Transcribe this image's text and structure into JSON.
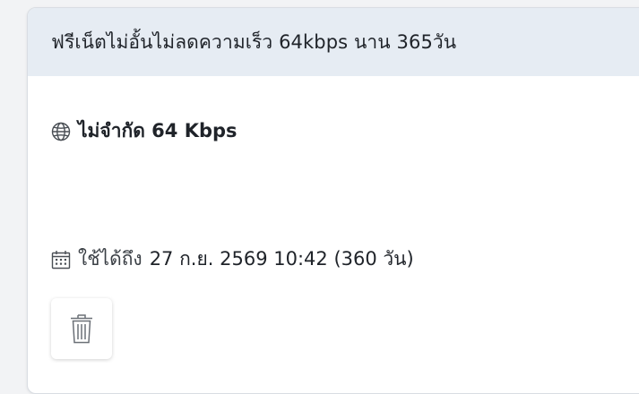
{
  "package": {
    "title": "ฟรีเน็ตไม่อั้นไม่ลดความเร็ว 64kbps นาน 365วัน",
    "speed_label": "ไม่จำกัด 64 Kbps",
    "speed_icon": "globe-icon",
    "expiry_prefix": "ใช้ได้ถึง",
    "expiry_value": "27 ก.ย. 2569 10:42 (360 วัน)",
    "expiry_icon": "calendar-icon"
  },
  "actions": {
    "delete_icon": "trash-icon"
  },
  "colors": {
    "header_bg": "#e6ecf3",
    "card_bg": "#ffffff",
    "text": "#1f2329"
  }
}
